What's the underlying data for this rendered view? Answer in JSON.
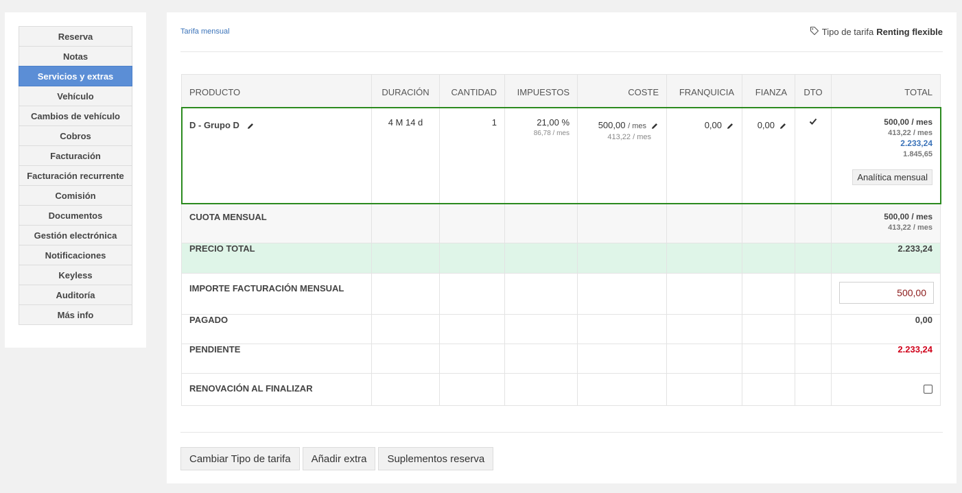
{
  "sidebar": {
    "items": [
      {
        "label": "Reserva"
      },
      {
        "label": "Notas"
      },
      {
        "label": "Servicios y extras",
        "active": true
      },
      {
        "label": "Vehículo"
      },
      {
        "label": "Cambios de vehículo"
      },
      {
        "label": "Cobros"
      },
      {
        "label": "Facturación"
      },
      {
        "label": "Facturación recurrente"
      },
      {
        "label": "Comisión"
      },
      {
        "label": "Documentos"
      },
      {
        "label": "Gestión electrónica"
      },
      {
        "label": "Notificaciones"
      },
      {
        "label": "Keyless"
      },
      {
        "label": "Auditoría"
      },
      {
        "label": "Más info"
      }
    ]
  },
  "header": {
    "tarifa_link": "Tarifa mensual",
    "tipo_label": "Tipo de tarifa",
    "tipo_value": "Renting flexible"
  },
  "table": {
    "columns": [
      "PRODUCTO",
      "DURACIÓN",
      "CANTIDAD",
      "IMPUESTOS",
      "COSTE",
      "FRANQUICIA",
      "FIANZA",
      "DTO",
      "TOTAL"
    ],
    "product": {
      "name": "D - Grupo D",
      "duracion": "4 M 14 d",
      "cantidad": "1",
      "impuestos_pct": "21,00 %",
      "impuestos_amount": "86,78",
      "per_mes": "/ mes",
      "coste": "500,00",
      "coste_base": "413,22",
      "franquicia": "0,00",
      "fianza": "0,00",
      "total_monthly": "500,00",
      "total_monthly_base": "413,22",
      "total": "2.233,24",
      "total_base": "1.845,65",
      "analitica_button": "Analítica mensual"
    },
    "cuota": {
      "label": "CUOTA MENSUAL",
      "value": "500,00",
      "base": "413,22"
    },
    "precio_total": {
      "label": "PRECIO TOTAL",
      "value": "2.233,24"
    },
    "importe": {
      "label": "IMPORTE FACTURACIÓN MENSUAL",
      "value": "500,00"
    },
    "pagado": {
      "label": "PAGADO",
      "value": "0,00"
    },
    "pendiente": {
      "label": "PENDIENTE",
      "value": "2.233,24"
    },
    "renovacion": {
      "label": "RENOVACIÓN AL FINALIZAR",
      "checked": false
    }
  },
  "footer": {
    "cambiar_button": "Cambiar Tipo de tarifa",
    "extra_button": "Añadir extra",
    "suplementos_button": "Suplementos reserva"
  },
  "colors": {
    "accent": "#5b8ed6",
    "selection_border": "#2b8a1e",
    "precio_bg": "#dff5e8",
    "danger": "#d0021b",
    "link": "#3b73b9"
  }
}
